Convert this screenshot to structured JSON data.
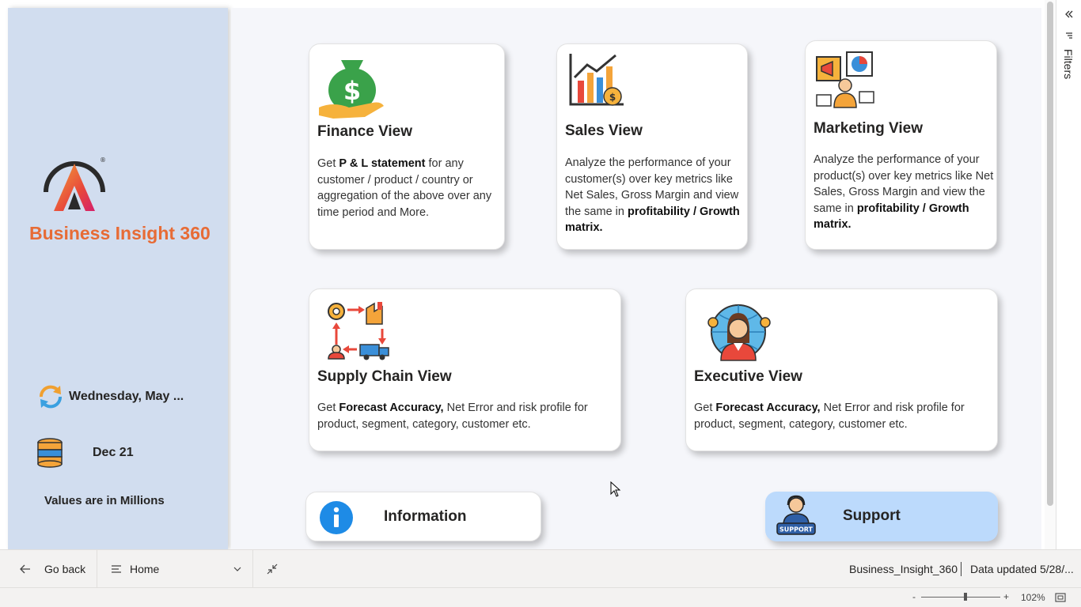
{
  "sidebar": {
    "brand": "Business Insight 360",
    "date_label": "Wednesday, May ...",
    "data_label": "Dec 21",
    "units_note": "Values are in Millions"
  },
  "cards": {
    "finance": {
      "title": "Finance View",
      "desc_pre": "Get ",
      "desc_bold": "P & L statement",
      "desc_post": " for any customer / product / country or aggregation of the above over any time period and More."
    },
    "sales": {
      "title": "Sales View",
      "desc_pre": "Analyze the performance of your customer(s) over key metrics like Net Sales, Gross Margin and view the same in ",
      "desc_bold": "profitability / Growth matrix."
    },
    "marketing": {
      "title": "Marketing View",
      "desc_pre": "Analyze the performance of your product(s) over key metrics like Net Sales, Gross Margin and view the same in ",
      "desc_bold": "profitability / Growth matrix."
    },
    "supply": {
      "title": "Supply Chain View",
      "desc_pre": "Get ",
      "desc_bold": "Forecast Accuracy,",
      "desc_post": " Net Error and risk profile for product, segment, category, customer etc."
    },
    "executive": {
      "title": "Executive View",
      "desc_pre": "Get ",
      "desc_bold": "Forecast Accuracy,",
      "desc_post": " Net Error and risk profile for product, segment, category, customer etc."
    }
  },
  "buttons": {
    "information": "Information",
    "support": "Support",
    "support_badge": "SUPPORT"
  },
  "filters_pane": {
    "label": "Filters"
  },
  "bottom_bar": {
    "go_back": "Go back",
    "page_selector": "Home",
    "report_name": "Business_Insight_360",
    "data_updated": "Data updated 5/28/..."
  },
  "zoom": {
    "minus": "-",
    "plus": "+",
    "level": "102%",
    "slider_fraction": 0.56
  },
  "colors": {
    "brand_orange": "#e76b35",
    "sidebar_bg": "#d1ddef",
    "support_bg": "#bcdafc",
    "info_blue": "#1e8be6"
  }
}
